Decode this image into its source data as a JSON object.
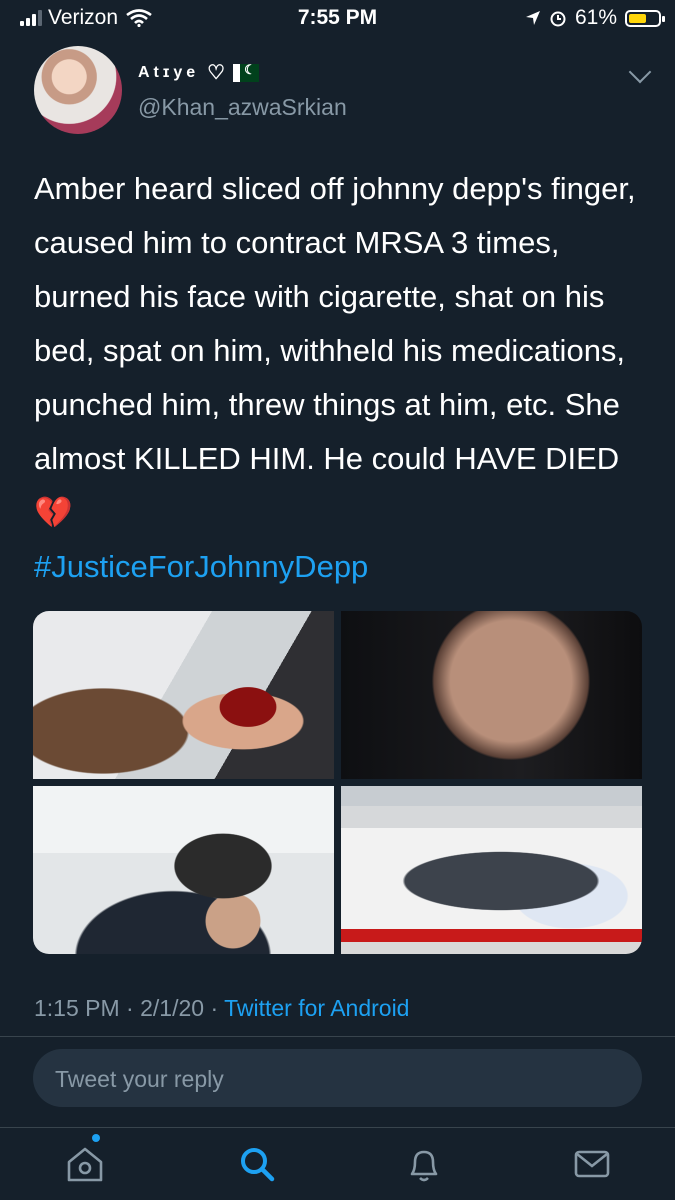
{
  "status_bar": {
    "carrier": "Verizon",
    "time": "7:55 PM",
    "battery": "61%",
    "battery_level": 0.61,
    "icons": [
      "signal-icon",
      "wifi-icon",
      "location-icon",
      "alarm-icon",
      "battery-icon"
    ]
  },
  "tweet": {
    "display_name": "Atɪye",
    "handle": "@Khan_azwaSrkian",
    "text": "Amber heard sliced off johnny depp's finger, caused him to contract MRSA 3 times, burned his face with cigarette, shat on his bed, spat on him, withheld his medications, punched him, threw things at him, etc. She almost KILLED HIM. He could HAVE DIED",
    "emoji": "💔",
    "hashtag": "#JusticeForJohnnyDepp",
    "time": "1:15 PM",
    "date": "2/1/20",
    "separator": "·",
    "source": "Twitter for Android",
    "media_count": 4
  },
  "reply": {
    "placeholder": "Tweet your reply"
  },
  "tabbar": {
    "items": [
      "home-icon",
      "search-icon",
      "notifications-icon",
      "messages-icon"
    ],
    "active": "search"
  },
  "colors": {
    "background": "#15202b",
    "accent": "#1da1f2",
    "muted": "#8899a6",
    "reply_bg": "#253341"
  }
}
